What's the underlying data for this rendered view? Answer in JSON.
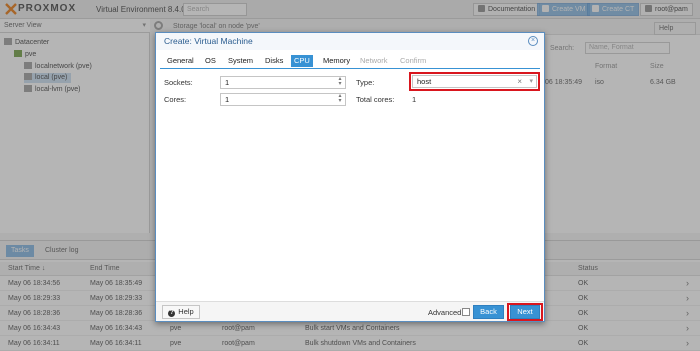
{
  "header": {
    "logo": "PROXMOX",
    "version": "Virtual Environment 8.4.0",
    "search_placeholder": "Search",
    "documentation": "Documentation",
    "create_vm": "Create VM",
    "create_ct": "Create CT",
    "user": "root@pam"
  },
  "sidebar": {
    "view": "Server View",
    "items": [
      {
        "label": "Datacenter"
      },
      {
        "label": "pve"
      },
      {
        "label": "localnetwork (pve)"
      },
      {
        "label": "local (pve)"
      },
      {
        "label": "local-lvm (pve)"
      }
    ]
  },
  "background": {
    "panel_title": "Storage 'local' on node 'pve'",
    "help": "Help",
    "search_label": "Search:",
    "search_placeholder": "Name, Format",
    "col_format": "Format",
    "col_size": "Size",
    "row_date": "06 18:35:49",
    "row_format": "iso",
    "row_size": "6.34 GB"
  },
  "log": {
    "tabs": [
      "Tasks",
      "Cluster log"
    ],
    "columns": {
      "start": "Start Time ↓",
      "end": "End Time",
      "status": "Status"
    },
    "rows": [
      {
        "start": "May 06 18:34:56",
        "end": "May 06 18:35:49",
        "node": "",
        "user": "",
        "desc": "",
        "status": "OK"
      },
      {
        "start": "May 06 18:29:33",
        "end": "May 06 18:29:33",
        "node": "",
        "user": "",
        "desc": "",
        "status": "OK"
      },
      {
        "start": "May 06 18:28:36",
        "end": "May 06 18:28:36",
        "node": "",
        "user": "",
        "desc": "",
        "status": "OK"
      },
      {
        "start": "May 06 16:34:43",
        "end": "May 06 16:34:43",
        "node": "pve",
        "user": "root@pam",
        "desc": "Bulk start VMs and Containers",
        "status": "OK"
      },
      {
        "start": "May 06 16:34:11",
        "end": "May 06 16:34:11",
        "node": "pve",
        "user": "root@pam",
        "desc": "Bulk shutdown VMs and Containers",
        "status": "OK"
      }
    ]
  },
  "dialog": {
    "title": "Create: Virtual Machine",
    "tabs": [
      "General",
      "OS",
      "System",
      "Disks",
      "CPU",
      "Memory",
      "Network",
      "Confirm"
    ],
    "active_tab": "CPU",
    "sockets_label": "Sockets:",
    "sockets_value": "1",
    "cores_label": "Cores:",
    "cores_value": "1",
    "type_label": "Type:",
    "type_value": "host",
    "total_cores_label": "Total cores:",
    "total_cores_value": "1",
    "help_label": "Help",
    "advanced_label": "Advanced",
    "back_label": "Back",
    "next_label": "Next"
  },
  "colors": {
    "accent": "#3892d4",
    "highlight": "#d9161e",
    "brand_orange": "#e57000"
  }
}
